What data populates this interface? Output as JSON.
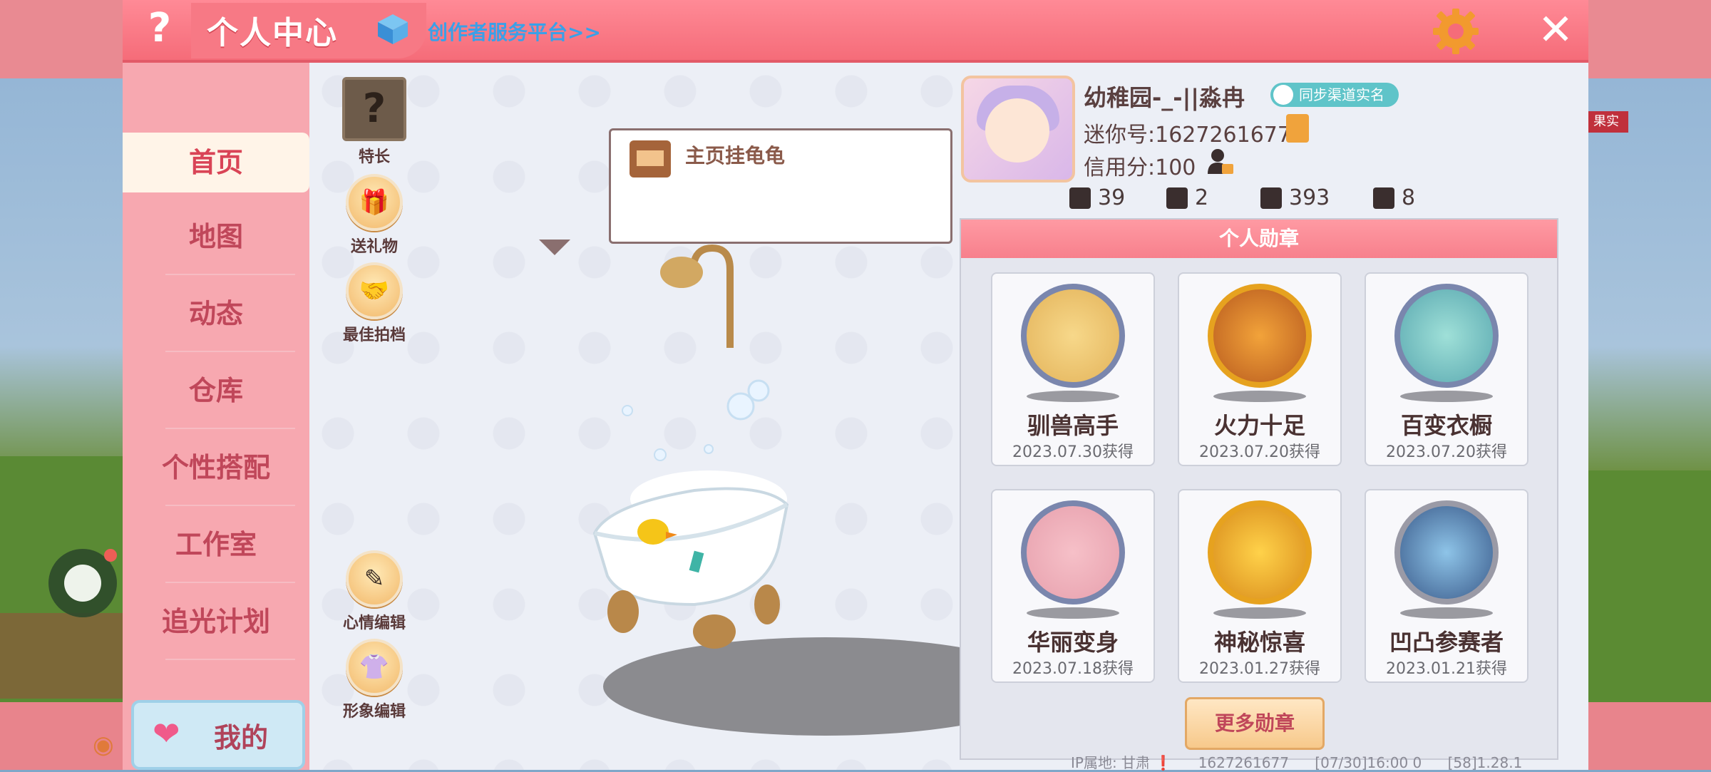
{
  "header": {
    "title": "个人中心",
    "creator_link": "创作者服务平台>>",
    "help_symbol": "?",
    "close_symbol": "✕"
  },
  "sidebar": {
    "items": [
      {
        "label": "首页",
        "active": true
      },
      {
        "label": "地图"
      },
      {
        "label": "动态"
      },
      {
        "label": "仓库"
      },
      {
        "label": "个性搭配"
      },
      {
        "label": "工作室"
      },
      {
        "label": "追光计划"
      }
    ],
    "mine_label": "我的"
  },
  "center": {
    "buttons": [
      {
        "label": "特长",
        "icon": "question-box-icon",
        "symbol": "?"
      },
      {
        "label": "送礼物",
        "icon": "gift-icon",
        "symbol": "🎁"
      },
      {
        "label": "最佳拍档",
        "icon": "handshake-icon",
        "symbol": "🤝"
      },
      {
        "label": "心情编辑",
        "icon": "edit-icon",
        "symbol": "✎"
      },
      {
        "label": "形象编辑",
        "icon": "outfit-icon",
        "symbol": "👚"
      }
    ],
    "bubble_text": "主页挂龟龟"
  },
  "profile": {
    "username": "幼稚园-_-||淼冉",
    "realname_badge": "同步渠道实名",
    "mini_id": "迷你号:1627261677",
    "credit": "信用分:100",
    "stats": [
      {
        "icon": "add-friend-icon",
        "value": "39"
      },
      {
        "icon": "fans-icon",
        "value": "2"
      },
      {
        "icon": "fire-icon",
        "value": "393"
      },
      {
        "icon": "likes-icon",
        "value": "8"
      }
    ]
  },
  "medals": {
    "title": "个人勋章",
    "items": [
      {
        "name": "驯兽高手",
        "date": "2023.07.30获得",
        "rim": "blue"
      },
      {
        "name": "火力十足",
        "date": "2023.07.20获得",
        "rim": "gold"
      },
      {
        "name": "百变衣橱",
        "date": "2023.07.20获得",
        "rim": "blue"
      },
      {
        "name": "华丽变身",
        "date": "2023.07.18获得",
        "rim": "blue"
      },
      {
        "name": "神秘惊喜",
        "date": "2023.01.27获得",
        "rim": "gold"
      },
      {
        "name": "凹凸参赛者",
        "date": "2023.01.21获得",
        "rim": "silver"
      }
    ],
    "more_label": "更多勋章"
  },
  "footer": {
    "ip": "IP属地: 甘肃 ❗",
    "uid": "1627261677",
    "time": "[07/30]16:00 0",
    "version": "[58]1.28.1"
  },
  "overlay": {
    "buy_tag": "果实"
  },
  "colors": {
    "header": "#f56c79",
    "sidebar": "#f7a8b0",
    "accent_text": "#c0475a"
  }
}
